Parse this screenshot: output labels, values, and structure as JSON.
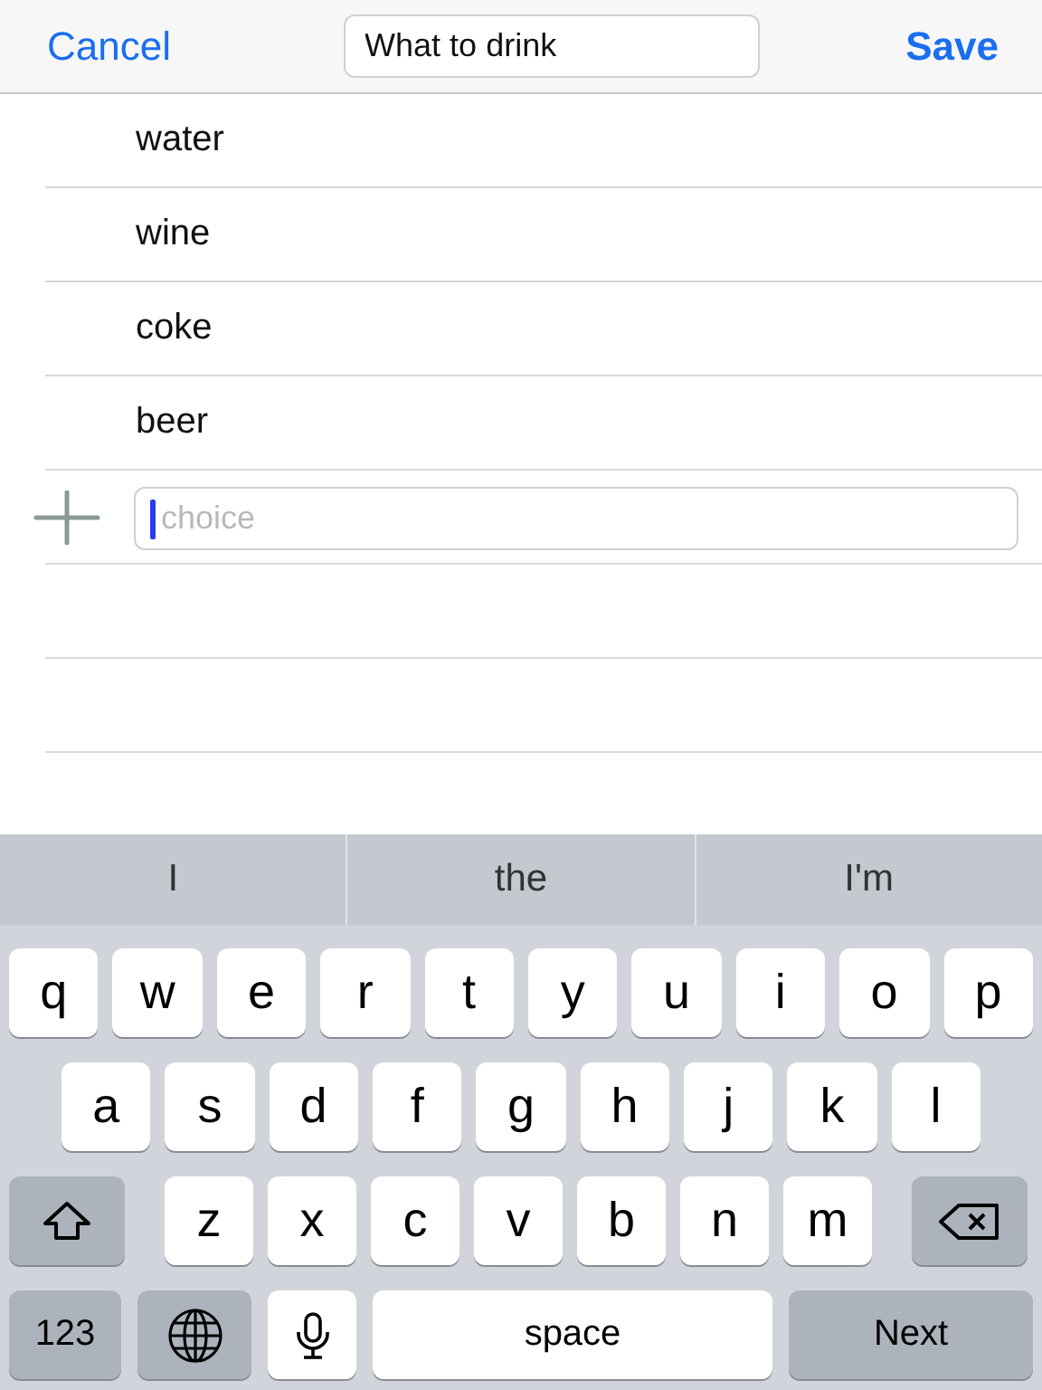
{
  "nav_bar": {
    "cancel": "Cancel",
    "title_value": "What to drink",
    "save": "Save"
  },
  "choices": [
    {
      "text": "water"
    },
    {
      "text": "wine"
    },
    {
      "text": "coke"
    },
    {
      "text": "beer"
    }
  ],
  "new_choice": {
    "placeholder": "choice"
  },
  "keyboard": {
    "suggestions": [
      "I",
      "the",
      "I'm"
    ],
    "rows": [
      {
        "keys": [
          {
            "kind": "letter",
            "label": "q"
          },
          {
            "kind": "letter",
            "label": "w"
          },
          {
            "kind": "letter",
            "label": "e"
          },
          {
            "kind": "letter",
            "label": "r"
          },
          {
            "kind": "letter",
            "label": "t"
          },
          {
            "kind": "letter",
            "label": "y"
          },
          {
            "kind": "letter",
            "label": "u"
          },
          {
            "kind": "letter",
            "label": "i"
          },
          {
            "kind": "letter",
            "label": "o"
          },
          {
            "kind": "letter",
            "label": "p"
          }
        ]
      },
      {
        "keys": [
          {
            "kind": "letter",
            "label": "a"
          },
          {
            "kind": "letter",
            "label": "s"
          },
          {
            "kind": "letter",
            "label": "d"
          },
          {
            "kind": "letter",
            "label": "f"
          },
          {
            "kind": "letter",
            "label": "g"
          },
          {
            "kind": "letter",
            "label": "h"
          },
          {
            "kind": "letter",
            "label": "j"
          },
          {
            "kind": "letter",
            "label": "k"
          },
          {
            "kind": "letter",
            "label": "l"
          }
        ]
      },
      {
        "keys": [
          {
            "kind": "shift"
          },
          {
            "kind": "letter",
            "label": "z"
          },
          {
            "kind": "letter",
            "label": "x"
          },
          {
            "kind": "letter",
            "label": "c"
          },
          {
            "kind": "letter",
            "label": "v"
          },
          {
            "kind": "letter",
            "label": "b"
          },
          {
            "kind": "letter",
            "label": "n"
          },
          {
            "kind": "letter",
            "label": "m"
          },
          {
            "kind": "backspace"
          }
        ]
      },
      {
        "keys": [
          {
            "kind": "mode",
            "label": "123"
          },
          {
            "kind": "globe"
          },
          {
            "kind": "mic"
          },
          {
            "kind": "space",
            "label": "space"
          },
          {
            "kind": "return",
            "label": "Next"
          }
        ]
      }
    ]
  }
}
